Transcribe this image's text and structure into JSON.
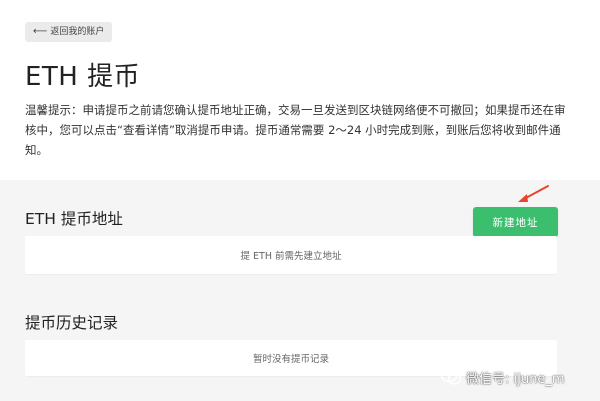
{
  "back_button": {
    "label": "返回我的账户",
    "icon": "arrow-left-icon"
  },
  "page_title": "ETH 提币",
  "notice": "温馨提示：申请提币之前请您确认提币地址正确，交易一旦发送到区块链网络便不可撤回；如果提币还在审核中，您可以点击“查看详情”取消提币申请。提币通常需要 2～24 小时完成到账，到账后您将收到邮件通知。",
  "address_section": {
    "title": "ETH 提币地址",
    "new_button_label": "新建地址",
    "empty_text": "提 ETH 前需先建立地址"
  },
  "history_section": {
    "title": "提币历史记录",
    "empty_text": "暂时没有提币记录"
  },
  "watermark": {
    "text": "微信号: iJune_m",
    "icon": "wechat-icon"
  },
  "colors": {
    "accent_green": "#3bbf6f",
    "annotation_red": "#e8452c",
    "panel_gray": "#f5f5f6"
  }
}
